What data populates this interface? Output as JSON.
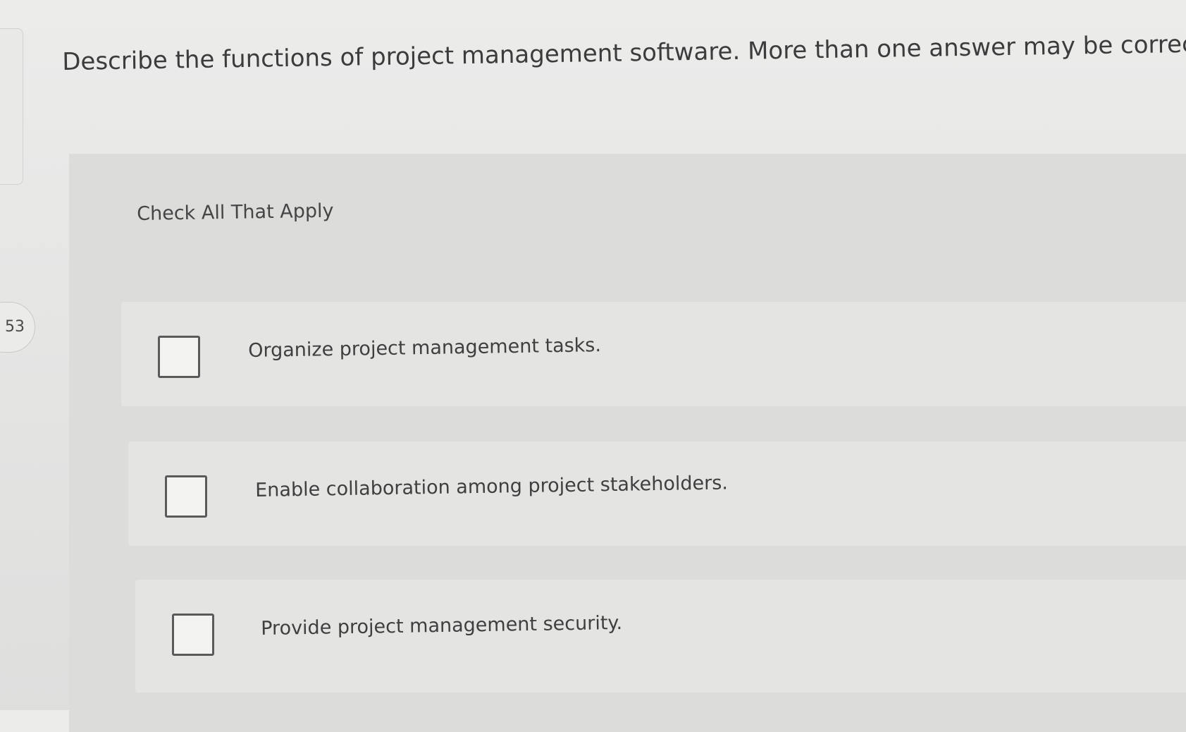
{
  "question": {
    "number": "53",
    "prompt": "Describe the functions of project management software. More than one answer may be correct."
  },
  "answer_section": {
    "instruction": "Check All That Apply",
    "options": [
      {
        "label": "Organize project management tasks.",
        "checked": false
      },
      {
        "label": "Enable collaboration among project stakeholders.",
        "checked": false
      },
      {
        "label": "Provide project management security.",
        "checked": false
      }
    ]
  }
}
